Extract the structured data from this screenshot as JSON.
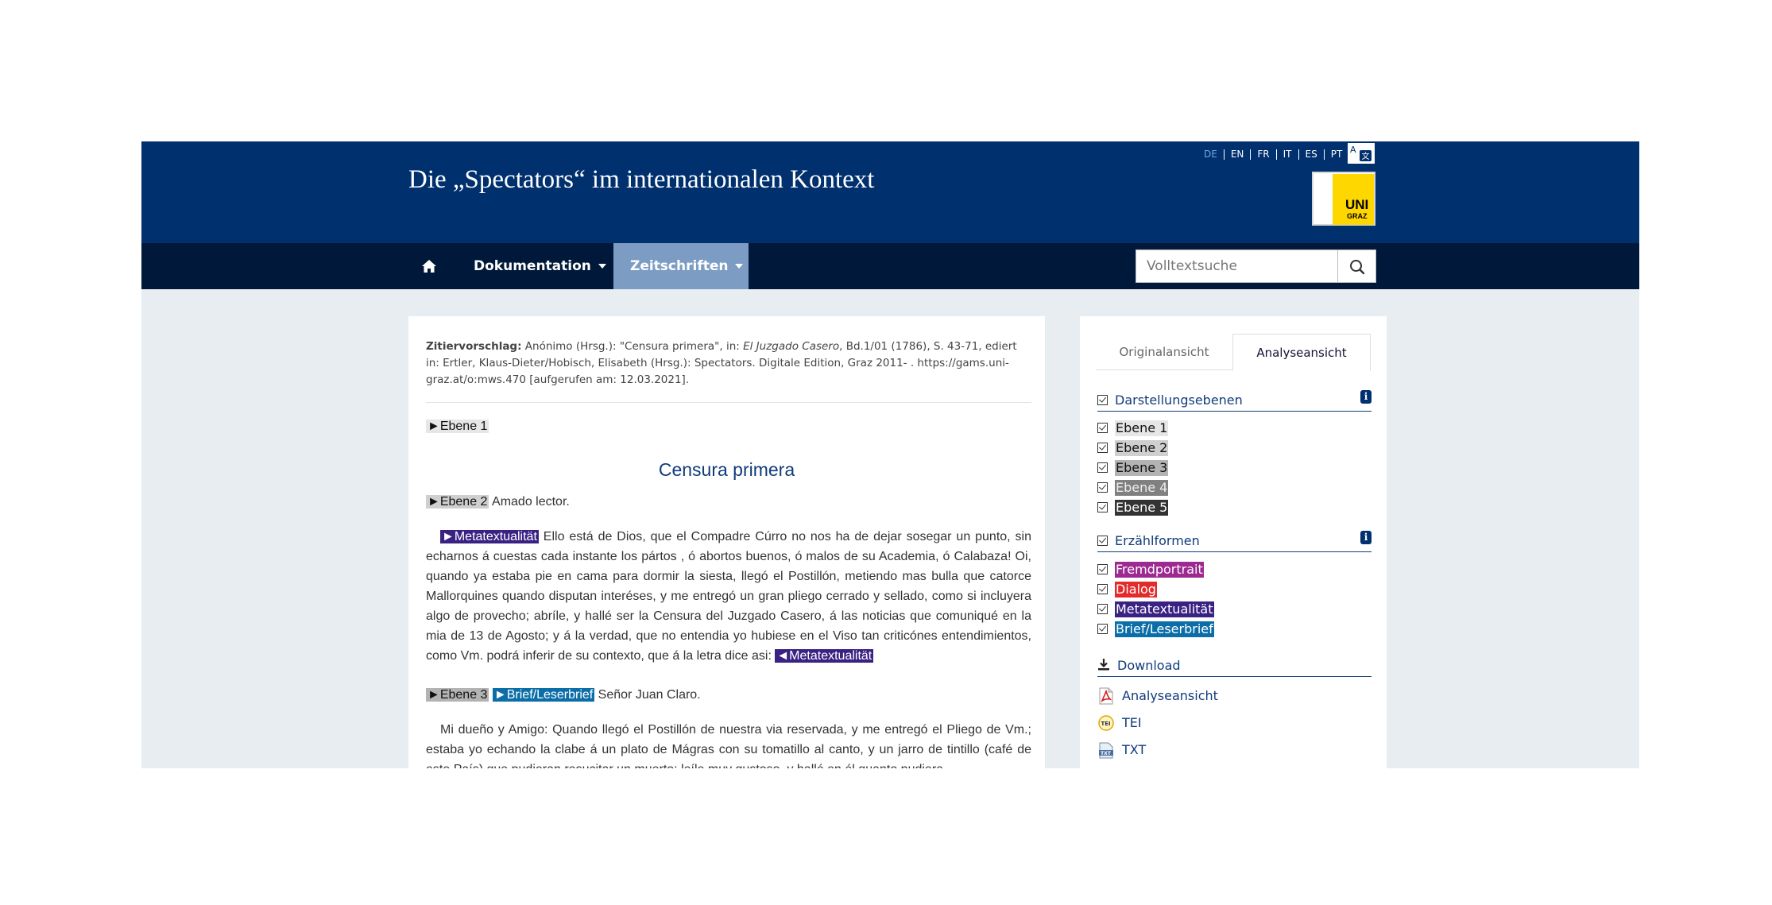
{
  "header": {
    "site_title": "Die „Spectators“ im internationalen Kontext",
    "languages": [
      "DE",
      "EN",
      "FR",
      "IT",
      "ES",
      "PT"
    ],
    "active_language": "DE",
    "logo_text_main": "UNI",
    "logo_text_sub": "GRAZ"
  },
  "nav": {
    "items": [
      {
        "label": "Dokumentation"
      },
      {
        "label": "Zeitschriften"
      }
    ],
    "search_placeholder": "Volltextsuche"
  },
  "citation": {
    "label": "Zitiervorschlag:",
    "text_before": " Anónimo (Hrsg.): \"Censura primera\", in: ",
    "journal": "El Juzgado Casero",
    "text_after": ", Bd.1/01 (1786), S. 43-71, ediert in: Ertler, Klaus-Dieter/Hobisch, Elisabeth (Hrsg.): Spectators. Digitale Edition, Graz 2011- . https://gams.uni-graz.at/o:mws.470 [aufgerufen am: 12.03.2021]."
  },
  "document": {
    "ebene1_marker": "►Ebene 1",
    "heading": "Censura primera",
    "ebene2_marker": "►Ebene 2",
    "ebene2_text": " Amado lector.",
    "meta_open": "►Metatextualität",
    "para1_text": " Ello está de Dios, que el Compadre Cúrro no nos ha de dejar sosegar un punto, sin echarnos á cuestas cada instante los pártos , ó abortos buenos, ó malos de su Academia, ó Calabaza! Oi, quando ya estaba pie en cama para dormir la siesta, llegó el Postillón, metiendo mas bulla que catorce Mallorquines quando disputan interéses, y me entregó un gran pliego cerrado y sellado, como si incluyera algo de provecho; abríle, y hallé ser la Censura del Juzgado Casero, á las noticias que comuniqué en la mia de 13 de Agosto; y á la verdad, que no entendia yo hubiese en el Viso tan criticónes entendimientos, como Vm. podrá inferir de su contexto, que á la letra dice asi: ",
    "meta_close": "◄Metatextualität",
    "ebene3_marker": "►Ebene 3",
    "brief_open": "►Brief/Leserbrief",
    "ebene3_text": " Señor Juan Claro.",
    "para2_text": "Mi dueño y Amigo: Quando llegó el Postillón de nuestra via reservada, y me entregó el Pliego de Vm.; estaba yo echando la clabe á un plato de Mágras con su tomatillo al canto, y un jarro de tintillo (café de este País) que pudieran resucitar un muerto: leíle muy gustoso, y hallé en él quanto pudiera"
  },
  "sidebar": {
    "tabs": [
      {
        "label": "Originalansicht"
      },
      {
        "label": "Analyseansicht"
      }
    ],
    "darstellung": {
      "title": "Darstellungsebenen",
      "info": "i",
      "items": [
        "Ebene 1",
        "Ebene 2",
        "Ebene 3",
        "Ebene 4",
        "Ebene 5"
      ]
    },
    "erzaehl": {
      "title": "Erzählformen",
      "info": "i",
      "items": [
        "Fremdportrait",
        "Dialog",
        "Metatextualität",
        "Brief/Leserbrief"
      ]
    },
    "download": {
      "title": "Download",
      "items": [
        "Analyseansicht",
        "TEI",
        "TXT"
      ],
      "tei_icon_text": "TEI",
      "txt_icon_text": "TXT"
    }
  },
  "colors": {
    "header_bg": "#00306d",
    "nav_bg": "#00193a",
    "nav_active": "#7c9cc3",
    "metatextualitaet": "#3a2283",
    "brief": "#0c6ea8",
    "fremdportrait": "#9c2a91",
    "dialog": "#e22b2b"
  }
}
